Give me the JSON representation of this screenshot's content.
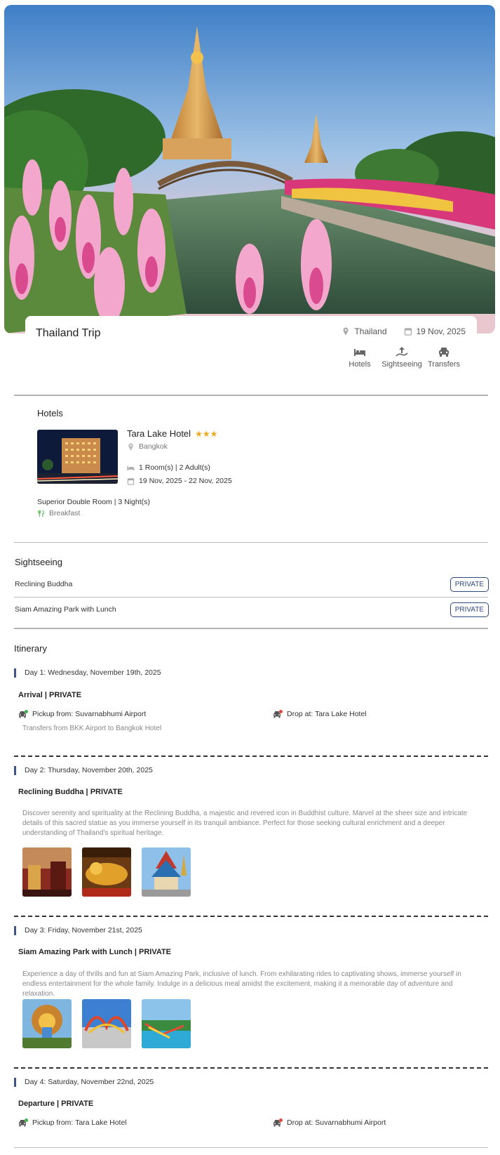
{
  "trip": {
    "title": "Thailand Trip",
    "location": "Thailand",
    "date": "19 Nov, 2025",
    "services": [
      {
        "label": "Hotels",
        "icon": "bed-icon"
      },
      {
        "label": "Sightseeing",
        "icon": "sightseeing-icon"
      },
      {
        "label": "Transfers",
        "icon": "car-icon"
      }
    ]
  },
  "hotels": {
    "section_title": "Hotels",
    "name": "Tara Lake Hotel",
    "stars": "★★★",
    "city": "Bangkok",
    "occupancy": "1 Room(s) | 2 Adult(s)",
    "dates": "19 Nov, 2025 - 22 Nov, 2025",
    "room": "Superior Double Room | 3 Night(s)",
    "meal": "Breakfast"
  },
  "sightseeing": {
    "section_title": "Sightseeing",
    "items": [
      {
        "name": "Reclining Buddha",
        "badge": "PRIVATE"
      },
      {
        "name": "Siam Amazing Park with Lunch",
        "badge": "PRIVATE"
      }
    ]
  },
  "itinerary": {
    "section_title": "Itinerary",
    "days": [
      {
        "label": "Day 1: Wednesday, November 19th, 2025",
        "heading": "Arrival | PRIVATE",
        "pickup": "Pickup from: Suvarnabhumi Airport",
        "drop": "Drop at: Tara Lake Hotel",
        "note": "Transfers from BKK Airport to Bangkok Hotel"
      },
      {
        "label": "Day 2: Thursday, November 20th, 2025",
        "heading": "Reclining Buddha | PRIVATE",
        "description": "Discover serenity and spirituality at the Reclining Buddha, a majestic and revered icon in Buddhist culture. Marvel at the sheer size and intricate details of this sacred statue as you immerse yourself in its tranquil ambiance. Perfect for those seeking cultural enrichment and a deeper understanding of Thailand's spiritual heritage."
      },
      {
        "label": "Day 3: Friday, November 21st, 2025",
        "heading": "Siam Amazing Park with Lunch | PRIVATE",
        "description": "Experience a day of thrills and fun at Siam Amazing Park, inclusive of lunch. From exhilarating rides to captivating shows, immerse yourself in endless entertainment for the whole family. Indulge in a delicious meal amidst the excitement, making it a memorable day of adventure and relaxation."
      },
      {
        "label": "Day 4: Saturday, November 22nd, 2025",
        "heading": "Departure | PRIVATE",
        "pickup": "Pickup from: Tara Lake Hotel",
        "drop": "Drop at: Suvarnabhumi Airport"
      }
    ]
  },
  "colors": {
    "accent": "#3e5386",
    "star": "#f0a81b",
    "pickup_badge": "#3bb54a",
    "drop_badge": "#e0463a"
  }
}
